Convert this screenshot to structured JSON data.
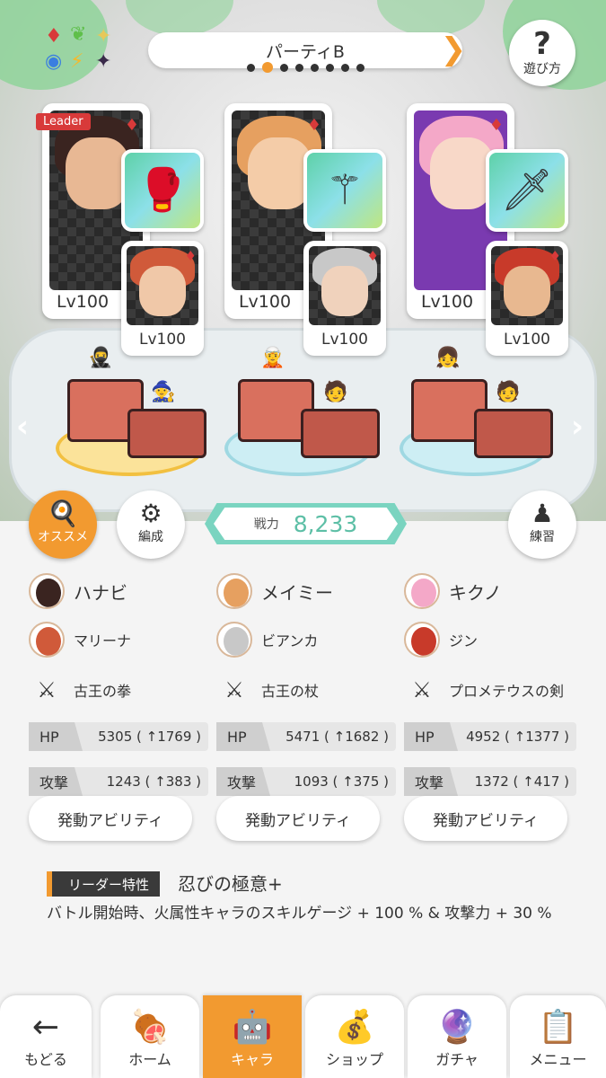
{
  "colors": {
    "accent": "#f29a30",
    "power": "#5dbfa6",
    "suit": "#d83a3a"
  },
  "header": {
    "party_name": "パーティB",
    "party_page_count": 8,
    "party_page_active": 2,
    "help_label": "遊び方"
  },
  "party": [
    {
      "main_level": "Lv100",
      "sub_level": "Lv100",
      "leader_tag": "Leader",
      "equip_icon": "gauntlet-icon"
    },
    {
      "main_level": "Lv100",
      "sub_level": "Lv100",
      "leader_tag": "",
      "equip_icon": "staff-icon"
    },
    {
      "main_level": "Lv100",
      "sub_level": "Lv100",
      "leader_tag": "",
      "equip_icon": "sword-icon"
    }
  ],
  "buttons": {
    "recommend": "オススメ",
    "formation": "編成",
    "practice": "練習",
    "ability": "発動アビリティ"
  },
  "power": {
    "label": "戦力",
    "value": "8,233"
  },
  "members": [
    {
      "name": "ハナビ",
      "sub": "マリーナ",
      "equip": "古王の拳",
      "hp": "5305 ( ↑1769 )",
      "atk": "1243 ( ↑383 )"
    },
    {
      "name": "メイミー",
      "sub": "ビアンカ",
      "equip": "古王の杖",
      "hp": "5471 ( ↑1682 )",
      "atk": "1093 ( ↑375 )"
    },
    {
      "name": "キクノ",
      "sub": "ジン",
      "equip": "プロメテウスの剣",
      "hp": "4952 ( ↑1377 )",
      "atk": "1372 ( ↑417 )"
    }
  ],
  "stat_labels": {
    "hp": "HP",
    "atk": "攻撃"
  },
  "leader": {
    "label": "リーダー特性",
    "skill": "忍びの極意+",
    "desc": "バトル開始時、火属性キャラのスキルゲージ + 100 % & 攻撃力 + 30 %"
  },
  "nav": [
    {
      "label": "もどる",
      "icon": "back-arrow-icon"
    },
    {
      "label": "ホーム",
      "icon": "home-icon"
    },
    {
      "label": "キャラ",
      "icon": "character-icon"
    },
    {
      "label": "ショップ",
      "icon": "shop-icon"
    },
    {
      "label": "ガチャ",
      "icon": "gacha-icon"
    },
    {
      "label": "メニュー",
      "icon": "menu-icon"
    }
  ]
}
